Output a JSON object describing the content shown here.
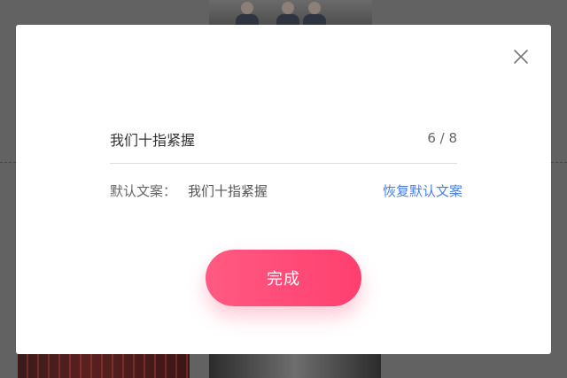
{
  "dialog": {
    "input_value": "我们十指紧握",
    "char_count": "6 / 8",
    "default_label": "默认文案：",
    "default_text": "我们十指紧握",
    "restore_label": "恢复默认文案",
    "done_label": "完成"
  },
  "colors": {
    "accent_pink": "#ff4f7a",
    "link_blue": "#4a7fe0",
    "overlay": "#626262"
  },
  "icons": {
    "close": "close-icon"
  }
}
